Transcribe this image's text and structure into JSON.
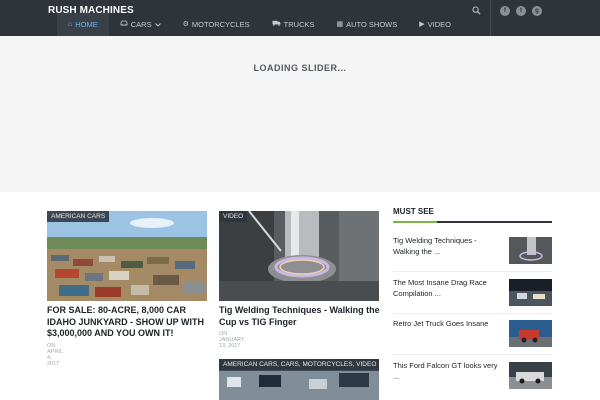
{
  "header": {
    "brand": "RUSH MACHINES",
    "nav": [
      {
        "label": "HOME",
        "icon": "home-icon",
        "glyph": "⌂",
        "active": true
      },
      {
        "label": "CARS",
        "icon": "car-icon",
        "glyph": "🚘",
        "caret": "⌄"
      },
      {
        "label": "MOTORCYCLES",
        "icon": "motorcycle-icon",
        "glyph": "⚙"
      },
      {
        "label": "TRUCKS",
        "icon": "truck-icon",
        "glyph": "⛟"
      },
      {
        "label": "AUTO SHOWS",
        "icon": "calendar-icon",
        "glyph": "▦"
      },
      {
        "label": "VIDEO",
        "icon": "play-icon",
        "glyph": "▶"
      }
    ],
    "search_icon": "search-icon",
    "social": [
      "facebook-icon",
      "twitter-icon",
      "google-plus-icon"
    ]
  },
  "slider": {
    "loading_text": "LOADING SLIDER..."
  },
  "posts": [
    {
      "category": "AMERICAN CARS",
      "title": "FOR SALE: 80-ACRE, 8,000 CAR IDAHO JUNKYARD - SHOW UP WITH $3,000,000 AND YOU OWN IT!",
      "date": "ON APRIL 4, 2017"
    },
    {
      "category": "VIDEO",
      "title": "Tig Welding Techniques - Walking the Cup vs TIG Finger",
      "date": "ON JANUARY 13, 2017"
    },
    {
      "category": "AMERICAN CARS, CARS, MOTORCYCLES, VIDEO",
      "title": "",
      "date": ""
    }
  ],
  "sidebar": {
    "heading": "MUST SEE",
    "items": [
      {
        "title": "Tig Welding Techniques - Walking the ..."
      },
      {
        "title": "The Most Insane Drag Race Compilation ..."
      },
      {
        "title": "Retro Jet Truck Goes Insane"
      },
      {
        "title": "This Ford Falcon GT looks very ..."
      }
    ]
  },
  "colors": {
    "header_bg": "#2f343b",
    "accent_blue": "#69b3e7",
    "accent_green": "#7cb342",
    "slider_bg": "#f5f5f5"
  }
}
